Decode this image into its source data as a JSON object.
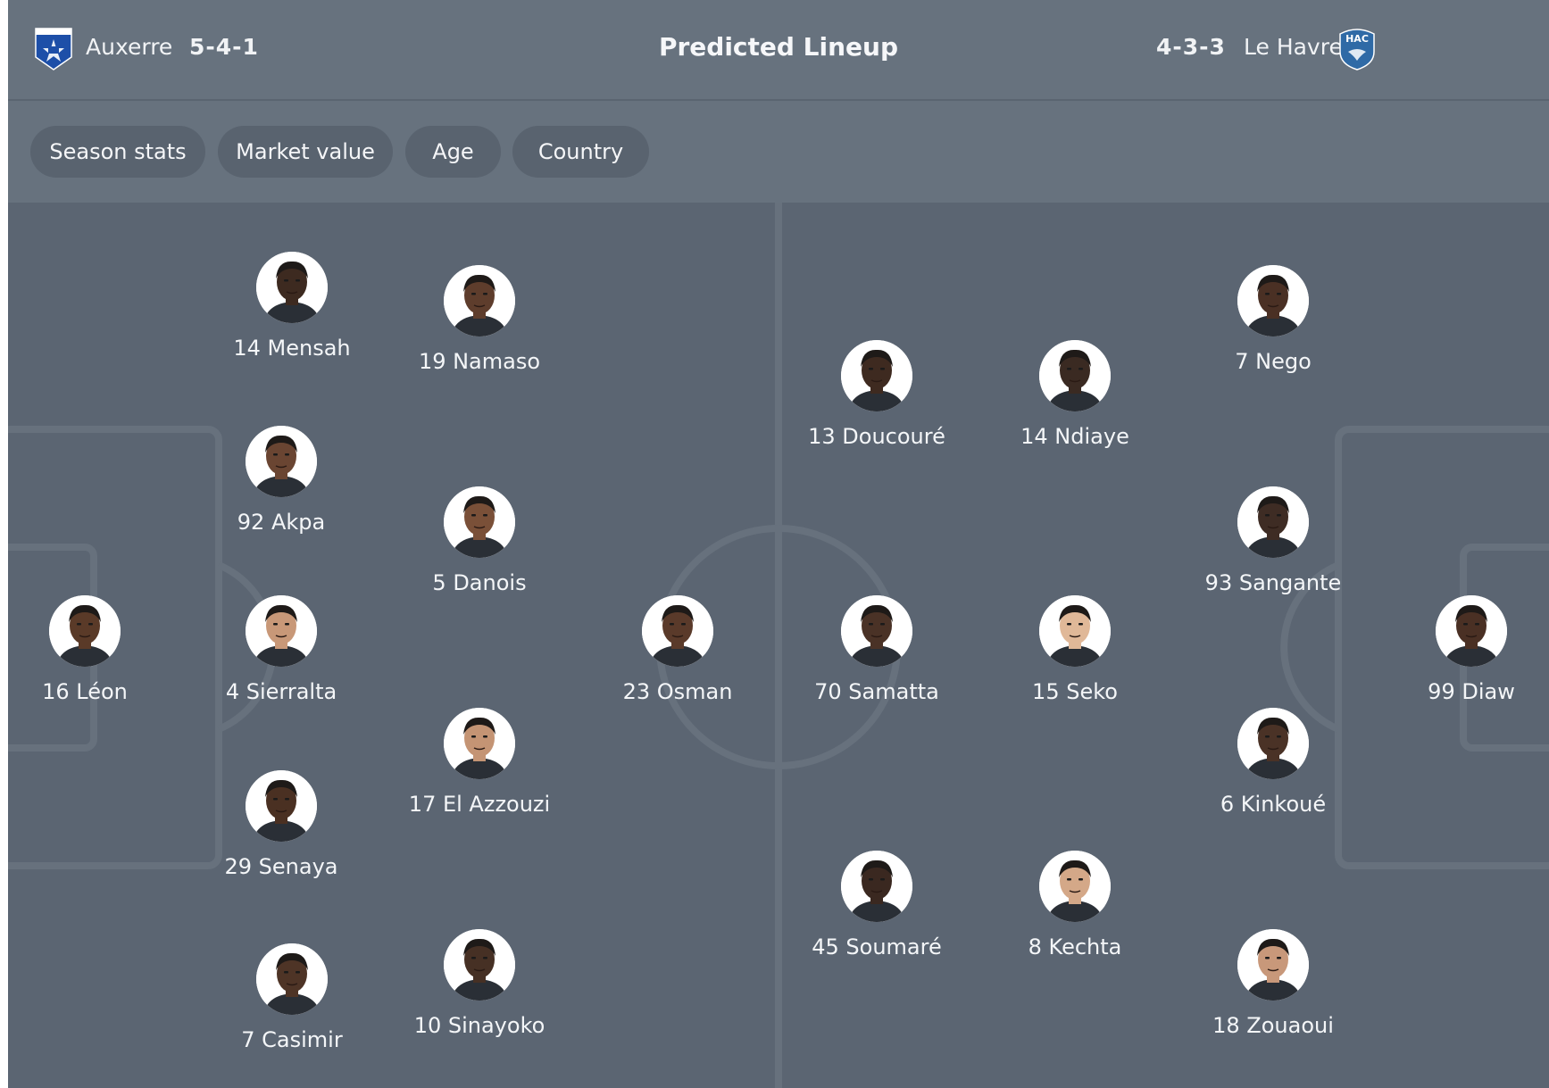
{
  "header": {
    "title": "Predicted Lineup",
    "home": {
      "name": "Auxerre",
      "formation": "5-4-1",
      "crest_text": "A.J.AUXERRE"
    },
    "away": {
      "name": "Le Havre",
      "formation": "4-3-3",
      "crest_text": "HAC"
    }
  },
  "tabs": [
    {
      "label": "Season stats"
    },
    {
      "label": "Market value"
    },
    {
      "label": "Age"
    },
    {
      "label": "Country"
    }
  ],
  "colors": {
    "header_bg": "#67727e",
    "pitch_bg": "#5b6572",
    "line": "#67717d",
    "home_crest": "#1d4fa8",
    "away_crest": "#2f6aa6"
  },
  "players": [
    {
      "label": "16 Léon",
      "skin": "#5a3a28"
    },
    {
      "label": "14 Mensah",
      "skin": "#3d2a20"
    },
    {
      "label": "92 Akpa",
      "skin": "#6a4532"
    },
    {
      "label": "4 Sierralta",
      "skin": "#c89878"
    },
    {
      "label": "29 Senaya",
      "skin": "#4a3022"
    },
    {
      "label": "7 Casimir",
      "skin": "#4e3426"
    },
    {
      "label": "19 Namaso",
      "skin": "#5e3d2c"
    },
    {
      "label": "5 Danois",
      "skin": "#7a5038"
    },
    {
      "label": "17 El Azzouzi",
      "skin": "#c49474"
    },
    {
      "label": "10 Sinayoko",
      "skin": "#463024"
    },
    {
      "label": "23 Osman",
      "skin": "#5a3a2a"
    },
    {
      "label": "70 Samatta",
      "skin": "#4a3226"
    },
    {
      "label": "13 Doucouré",
      "skin": "#3e2a20"
    },
    {
      "label": "45 Soumaré",
      "skin": "#3a2820"
    },
    {
      "label": "15 Seko",
      "skin": "#e0b898"
    },
    {
      "label": "14 Ndiaye",
      "skin": "#3a2a22"
    },
    {
      "label": "8 Kechta",
      "skin": "#d4a888"
    },
    {
      "label": "7 Nego",
      "skin": "#4a3024"
    },
    {
      "label": "93 Sangante",
      "skin": "#3e2c24"
    },
    {
      "label": "6 Kinkoué",
      "skin": "#4a3226"
    },
    {
      "label": "18 Zouaoui",
      "skin": "#c8987a"
    },
    {
      "label": "99 Diaw",
      "skin": "#4a3024"
    }
  ]
}
